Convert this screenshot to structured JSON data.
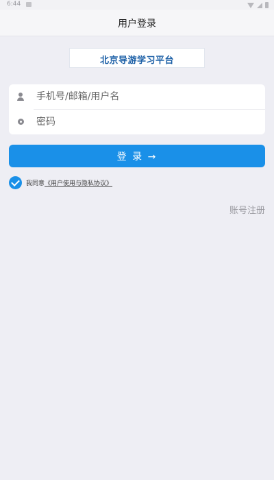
{
  "status_bar": {
    "time": "6:44"
  },
  "header": {
    "title": "用户登录"
  },
  "logo": {
    "text": "北京导游学习平台"
  },
  "form": {
    "username_placeholder": "手机号/邮箱/用户名",
    "username_icon": "user-icon",
    "password_placeholder": "密码",
    "password_icon": "key-icon"
  },
  "login_button": {
    "label": "登 录 →",
    "color": "#1a90e8"
  },
  "agreement": {
    "checked": true,
    "prefix": "我同意",
    "link_text": "《用户使用与隐私协议》"
  },
  "register": {
    "label": "账号注册"
  },
  "colors": {
    "accent": "#1a90e8",
    "background": "#eeeef4",
    "logo_text": "#1b5fa6"
  }
}
